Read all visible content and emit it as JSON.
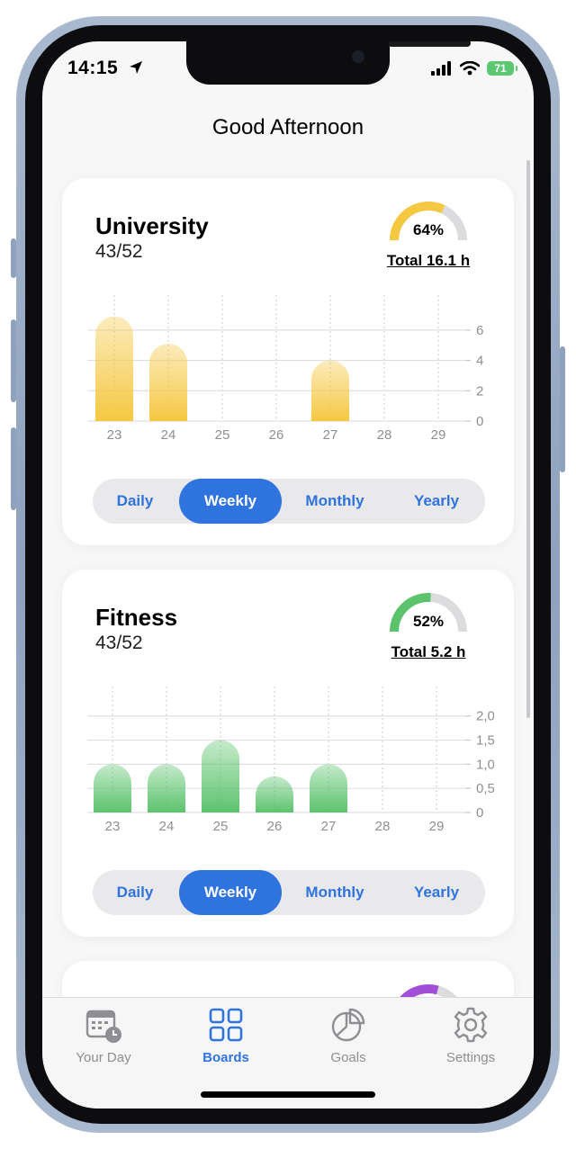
{
  "status": {
    "time": "14:15",
    "battery": "71"
  },
  "header": {
    "title": "Good Afternoon"
  },
  "cards": [
    {
      "title": "University",
      "count": "43/52",
      "percent_label": "64%",
      "percent": 0.64,
      "total": "Total 16.1 h",
      "color": "#f5c842",
      "chart_data": {
        "type": "bar",
        "categories": [
          "23",
          "24",
          "25",
          "26",
          "27",
          "28",
          "29"
        ],
        "values": [
          6.9,
          5.1,
          0,
          0,
          4.0,
          0,
          0
        ],
        "ylim": [
          0,
          7
        ],
        "yticks": [
          "0",
          "2",
          "4",
          "6"
        ],
        "ytick_values": [
          0,
          2,
          4,
          6
        ]
      },
      "tabs": [
        "Daily",
        "Weekly",
        "Monthly",
        "Yearly"
      ],
      "active_tab": 1
    },
    {
      "title": "Fitness",
      "count": "43/52",
      "percent_label": "52%",
      "percent": 0.52,
      "total": "Total 5.2 h",
      "color": "#5cc36d",
      "chart_data": {
        "type": "bar",
        "categories": [
          "23",
          "24",
          "25",
          "26",
          "27",
          "28",
          "29"
        ],
        "values": [
          1.0,
          1.0,
          1.5,
          0.75,
          1.0,
          0,
          0
        ],
        "ylim": [
          0,
          2.2
        ],
        "yticks": [
          "0",
          "0,5",
          "1,0",
          "1,5",
          "2,0"
        ],
        "ytick_values": [
          0,
          0.5,
          1.0,
          1.5,
          2.0
        ]
      },
      "tabs": [
        "Daily",
        "Weekly",
        "Monthly",
        "Yearly"
      ],
      "active_tab": 1
    }
  ],
  "third_card_color": "#a14fd8",
  "tabbar": {
    "items": [
      {
        "label": "Your Day",
        "icon": "calendar-clock-icon"
      },
      {
        "label": "Boards",
        "icon": "grid-icon"
      },
      {
        "label": "Goals",
        "icon": "pie-chart-icon"
      },
      {
        "label": "Settings",
        "icon": "gear-icon"
      }
    ],
    "active": 1
  }
}
